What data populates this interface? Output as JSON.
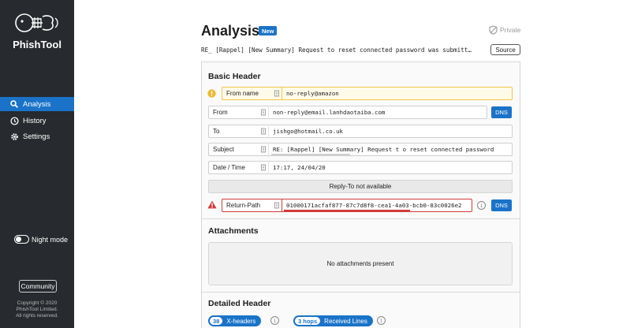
{
  "sidebar": {
    "brand": "PhishTool",
    "nav": [
      {
        "label": "Analysis",
        "active": true,
        "icon": "search-icon"
      },
      {
        "label": "History",
        "active": false,
        "icon": "clock-icon"
      },
      {
        "label": "Settings",
        "active": false,
        "icon": "gear-icon"
      }
    ],
    "night_mode_label": "Night mode",
    "community_label": "Community",
    "copyright": [
      "Copyright © 2020",
      "PhishTool Limited.",
      "All rights reserved."
    ]
  },
  "header": {
    "title": "Analysis",
    "badge": "New",
    "private_label": "Private",
    "subject": "RE_ [Rappel] [New Summary] Request to reset connected password was submitt…",
    "source_label": "Source"
  },
  "basic_header": {
    "title": "Basic Header",
    "from_name": {
      "label": "From name",
      "value": "no-reply@amazon"
    },
    "from": {
      "label": "From",
      "value": "non-reply@email.lanhdaotaiba.com"
    },
    "to": {
      "label": "To",
      "value": "jishgo@hotmail.co.uk"
    },
    "subject": {
      "label": "Subject",
      "value": "RE: [Rappel] [New Summary] Request t o reset connected password"
    },
    "date_time": {
      "label": "Date / Time",
      "value": "17:17, 24/04/20"
    },
    "reply_to": "Reply-To not available",
    "return_path": {
      "label": "Return-Path",
      "value": "01000171acfaf877-87c7d8f8-cea1-4a03-bcb0-83c0026e2"
    },
    "dns_label": "DNS"
  },
  "attachments": {
    "title": "Attachments",
    "empty": "No attachments present"
  },
  "detailed_header": {
    "title": "Detailed Header",
    "x_headers": {
      "count": "38",
      "label": "X-headers"
    },
    "received": {
      "count": "3 hops",
      "label": "Received Lines"
    }
  },
  "colors": {
    "accent": "#1a73c9",
    "sidebar": "#272a2e",
    "warning": "#efc64a",
    "danger": "#d33a3a"
  }
}
